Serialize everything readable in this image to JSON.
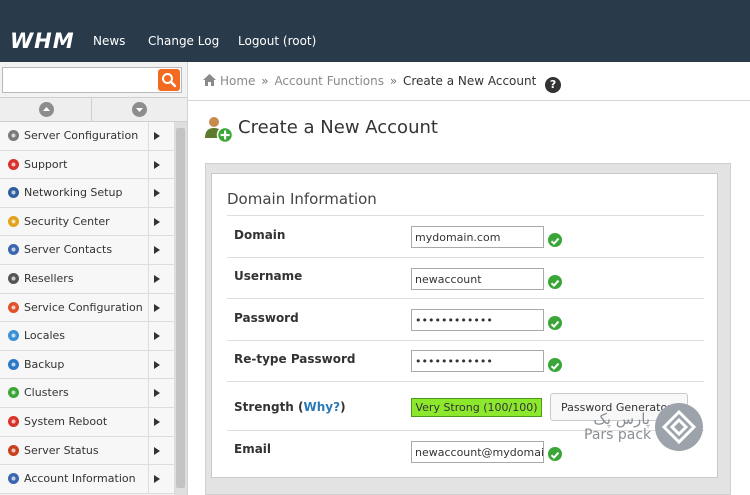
{
  "header": {
    "logo": "WHM",
    "nav": [
      "News",
      "Change Log",
      "Logout (root)"
    ]
  },
  "sidebar": {
    "search_placeholder": "",
    "items": [
      {
        "label": "Server Configuration",
        "icon": "server-config-icon",
        "color": "#7a7a7a"
      },
      {
        "label": "Support",
        "icon": "support-lifebuoy-icon",
        "color": "#d9322a"
      },
      {
        "label": "Networking Setup",
        "icon": "network-globe-icon",
        "color": "#2f5f9e"
      },
      {
        "label": "Security Center",
        "icon": "lock-icon",
        "color": "#e3a21a"
      },
      {
        "label": "Server Contacts",
        "icon": "contacts-icon",
        "color": "#3a66b0"
      },
      {
        "label": "Resellers",
        "icon": "resellers-icon",
        "color": "#555555"
      },
      {
        "label": "Service Configuration",
        "icon": "service-config-icon",
        "color": "#e0522b"
      },
      {
        "label": "Locales",
        "icon": "locales-chat-icon",
        "color": "#3b8fd6"
      },
      {
        "label": "Backup",
        "icon": "backup-icon",
        "color": "#2a78c8"
      },
      {
        "label": "Clusters",
        "icon": "clusters-icon",
        "color": "#3aa637"
      },
      {
        "label": "System Reboot",
        "icon": "power-icon",
        "color": "#d9322a"
      },
      {
        "label": "Server Status",
        "icon": "gauge-icon",
        "color": "#c8411c"
      },
      {
        "label": "Account Information",
        "icon": "account-info-icon",
        "color": "#3a66b0"
      }
    ]
  },
  "breadcrumb": {
    "home": "Home",
    "sep": "»",
    "section": "Account Functions",
    "current": "Create a New Account",
    "help": "?"
  },
  "page": {
    "title": "Create a New Account",
    "section_title": "Domain Information"
  },
  "form": {
    "domain_label": "Domain",
    "domain_value": "mydomain.com",
    "username_label": "Username",
    "username_value": "newaccount",
    "password_label": "Password",
    "password_value": "••••••••••••",
    "retype_label": "Re-type Password",
    "retype_value": "••••••••••••",
    "strength_label": "Strength",
    "strength_open": "(",
    "strength_why": "Why?",
    "strength_close": ")",
    "strength_value": "Very Strong (100/100)",
    "password_generator": "Password Generator",
    "email_label": "Email",
    "email_value": "newaccount@mydomain.com"
  },
  "watermark": {
    "text_fa": "پارس پک",
    "text_en": "Pars pack"
  },
  "colors": {
    "topbar": "#293a4a",
    "search_button": "#f26b21",
    "valid_check": "#3aa637",
    "strength_fill": "#8be82d",
    "link": "#2a7ab8"
  }
}
